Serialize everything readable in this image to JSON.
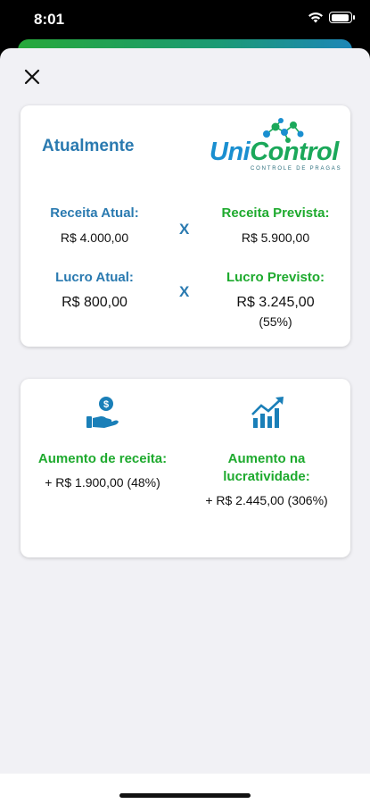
{
  "status": {
    "time": "8:01"
  },
  "comparison": {
    "heading": "Atualmente",
    "logo": {
      "brand_part1": "Uni",
      "brand_part2": "Control",
      "tagline": "CONTROLE DE PRAGAS"
    },
    "x_symbol": "X",
    "current_revenue": {
      "label": "Receita Atual:",
      "value": "R$ 4.000,00"
    },
    "projected_revenue": {
      "label": "Receita Prevista:",
      "value": "R$ 5.900,00"
    },
    "current_profit": {
      "label": "Lucro Atual:",
      "value": "R$ 800,00"
    },
    "projected_profit": {
      "label": "Lucro Previsto:",
      "value": "R$ 3.245,00",
      "percent": "(55%)"
    }
  },
  "increase": {
    "revenue": {
      "label": "Aumento de receita:",
      "value": "+ R$ 1.900,00 (48%)"
    },
    "profitability": {
      "label_line1": "Aumento na",
      "label_line2": "lucratividade:",
      "value": "+ R$ 2.445,00 (306%)"
    }
  },
  "colors": {
    "blue": "#2a7ab0",
    "green": "#1eaa2e"
  },
  "icons": [
    "close-icon",
    "money-hand-icon",
    "growth-chart-icon",
    "wifi-icon",
    "battery-icon"
  ]
}
